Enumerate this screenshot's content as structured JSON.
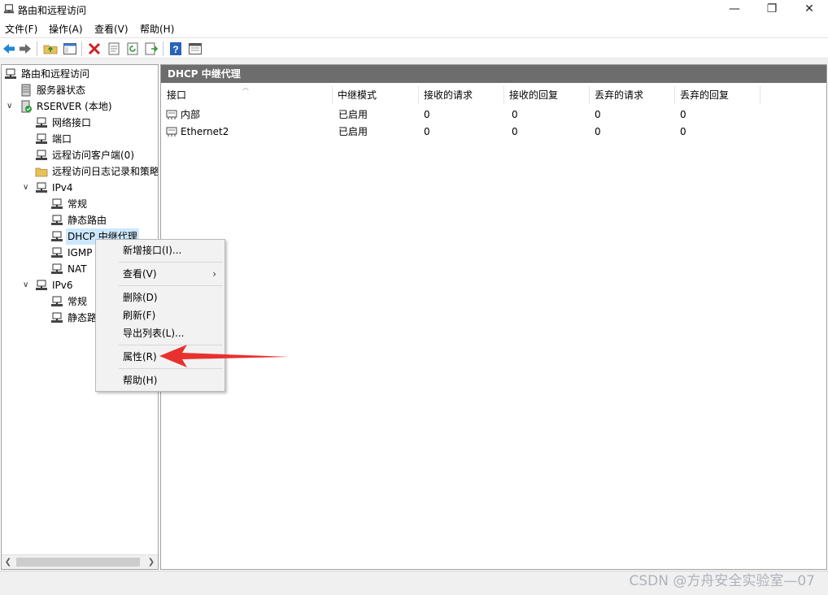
{
  "window": {
    "title": "路由和远程访问",
    "minimize_glyph": "—",
    "restore_glyph": "❐",
    "close_glyph": "✕"
  },
  "menu": [
    {
      "label": "文件(F)"
    },
    {
      "label": "操作(A)"
    },
    {
      "label": "查看(V)"
    },
    {
      "label": "帮助(H)"
    }
  ],
  "toolbar": {
    "icons": [
      "back-arrow-icon",
      "forward-arrow-icon",
      "up-folder-icon",
      "show-hide-tree-icon",
      "delete-icon",
      "properties-icon",
      "refresh-icon",
      "export-list-icon",
      "help-icon",
      "view-icon"
    ]
  },
  "tree": {
    "root": "路由和远程访问",
    "server_status": "服务器状态",
    "server": "RSERVER (本地)",
    "network_interfaces": "网络接口",
    "ports": "端口",
    "remote_clients": "远程访问客户端(0)",
    "remote_logging": "远程访问日志记录和策略",
    "ipv4": "IPv4",
    "ipv4_general": "常规",
    "ipv4_static_routes": "静态路由",
    "dhcp_relay": "DHCP 中继代理",
    "igmp": "IGMP",
    "nat": "NAT",
    "ipv6": "IPv6",
    "ipv6_general": "常规",
    "ipv6_static_routes": "静态路由"
  },
  "panel": {
    "title": "DHCP 中继代理",
    "columns": [
      "接口",
      "中继模式",
      "接收的请求",
      "接收的回复",
      "丢弃的请求",
      "丢弃的回复"
    ],
    "rows": [
      {
        "interface": "内部",
        "mode": "已启用",
        "req_recv": "0",
        "rep_recv": "0",
        "req_drop": "0",
        "rep_drop": "0"
      },
      {
        "interface": "Ethernet2",
        "mode": "已启用",
        "req_recv": "0",
        "rep_recv": "0",
        "req_drop": "0",
        "rep_drop": "0"
      }
    ]
  },
  "context_menu": {
    "new_interface": "新增接口(I)...",
    "view": "查看(V)",
    "delete": "删除(D)",
    "refresh": "刷新(F)",
    "export_list": "导出列表(L)...",
    "properties": "属性(R)",
    "help": "帮助(H)"
  },
  "annotation": {
    "arrow_color": "#e8312f"
  },
  "watermark": "CSDN @方舟安全实验室—07"
}
